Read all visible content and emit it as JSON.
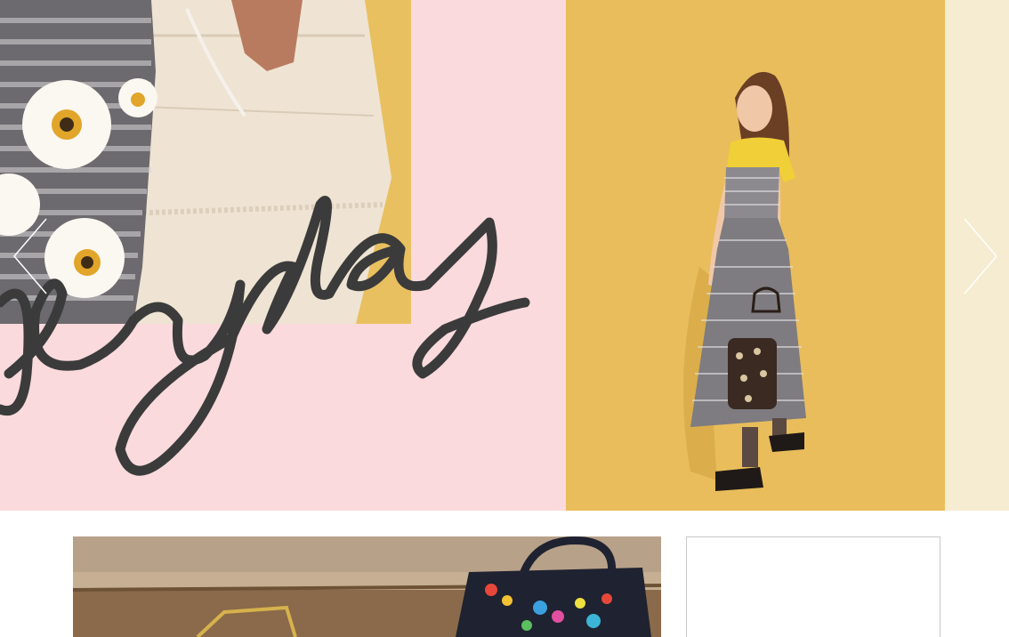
{
  "hero": {
    "script_text": "heyday",
    "colors": {
      "pink_panel": "#fadadd",
      "yellow_panel": "#e9bd5c",
      "cream_panel": "#f6ecd1",
      "script_ink": "#3b3b3b"
    }
  },
  "carousel": {
    "prev_icon": "chevron-left-icon",
    "next_icon": "chevron-right-icon"
  }
}
